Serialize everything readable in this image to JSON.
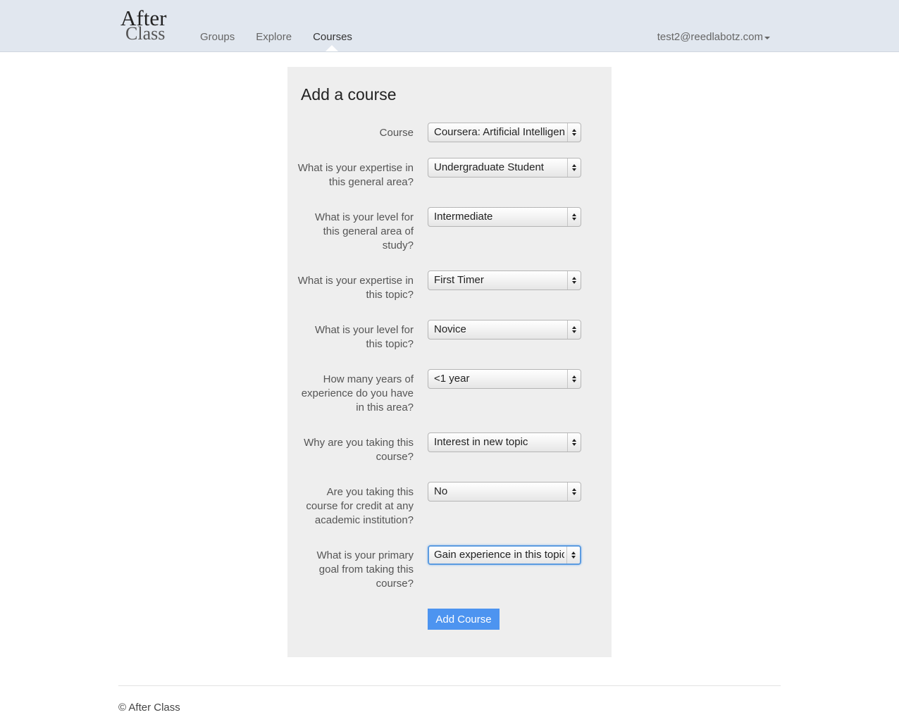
{
  "brand": {
    "line1": "After",
    "line2": "Class"
  },
  "nav": {
    "items": [
      {
        "label": "Groups",
        "active": false
      },
      {
        "label": "Explore",
        "active": false
      },
      {
        "label": "Courses",
        "active": true
      }
    ],
    "user_email": "test2@reedlabotz.com"
  },
  "form": {
    "title": "Add a course",
    "fields": [
      {
        "label": "Course",
        "value": "Coursera: Artificial Intelligence"
      },
      {
        "label": "What is your expertise in this general area?",
        "value": "Undergraduate Student"
      },
      {
        "label": "What is your level for this general area of study?",
        "value": "Intermediate"
      },
      {
        "label": "What is your expertise in this topic?",
        "value": "First Timer"
      },
      {
        "label": "What is your level for this topic?",
        "value": "Novice"
      },
      {
        "label": "How many years of experience do you have in this area?",
        "value": "<1 year"
      },
      {
        "label": "Why are you taking this course?",
        "value": "Interest in new topic"
      },
      {
        "label": "Are you taking this course for credit at any academic institution?",
        "value": "No"
      },
      {
        "label": "What is your primary goal from taking this course?",
        "value": "Gain experience in this topic",
        "focused": true
      }
    ],
    "submit_label": "Add Course"
  },
  "footer": {
    "text": "© After Class"
  },
  "colors": {
    "navbar_bg": "#e1e7ef",
    "panel_bg": "#eeeeee",
    "button_bg": "#4d94f0",
    "focus_ring": "#5b9be0"
  }
}
